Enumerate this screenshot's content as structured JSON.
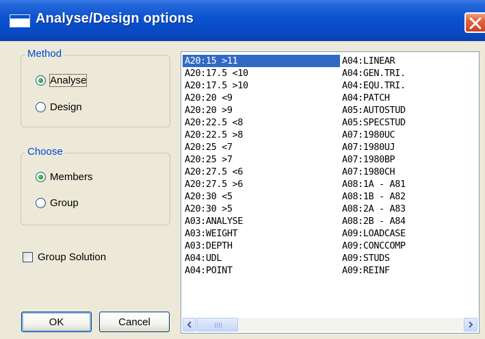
{
  "window": {
    "title": "Analyse/Design options"
  },
  "method": {
    "legend": "Method",
    "options": [
      {
        "label": "Analyse",
        "checked": true
      },
      {
        "label": "Design",
        "checked": false
      }
    ]
  },
  "choose": {
    "legend": "Choose",
    "options": [
      {
        "label": "Members",
        "checked": true
      },
      {
        "label": "Group",
        "checked": false
      }
    ]
  },
  "group_solution": {
    "label": "Group Solution",
    "checked": false
  },
  "buttons": {
    "ok": "OK",
    "cancel": "Cancel"
  },
  "list": {
    "selected": "A20:15 >11",
    "columns": [
      [
        "A20:15 >11",
        "A20:17.5 <10",
        "A20:17.5 >10",
        "A20:20 <9",
        "A20:20 >9",
        "A20:22.5 <8",
        "A20:22.5 >8",
        "A20:25 <7",
        "A20:25 >7",
        "A20:27.5 <6",
        "A20:27.5 >6",
        "A20:30 <5",
        "A20:30 >5",
        "A03:ANALYSE",
        "A03:WEIGHT",
        "A03:DEPTH",
        "A04:UDL",
        "A04:POINT"
      ],
      [
        "A04:LINEAR",
        "A04:GEN.TRI.",
        "A04:EQU.TRI.",
        "A04:PATCH",
        "A05:AUTOSTUD",
        "A05:SPECSTUD",
        "A07:1980UC",
        "A07:1980UJ",
        "A07:1980BP",
        "A07:1980CH",
        "A08:1A - A81",
        "A08:1B - A82",
        "A08:2A - A83",
        "A08:2B - A84",
        "A09:LOADCASE",
        "A09:CONCCOMP",
        "A09:STUDS",
        "A09:REINF"
      ]
    ]
  },
  "icons": {
    "window": "window-icon",
    "close": "close-icon",
    "scroll_left": "scroll-left-icon",
    "scroll_right": "scroll-right-icon"
  },
  "colors": {
    "titlebar": "#0b52cf",
    "legend_text": "#0046d5",
    "selection": "#316ac5",
    "close": "#e1623f",
    "dialog_bg": "#ece9d8"
  }
}
